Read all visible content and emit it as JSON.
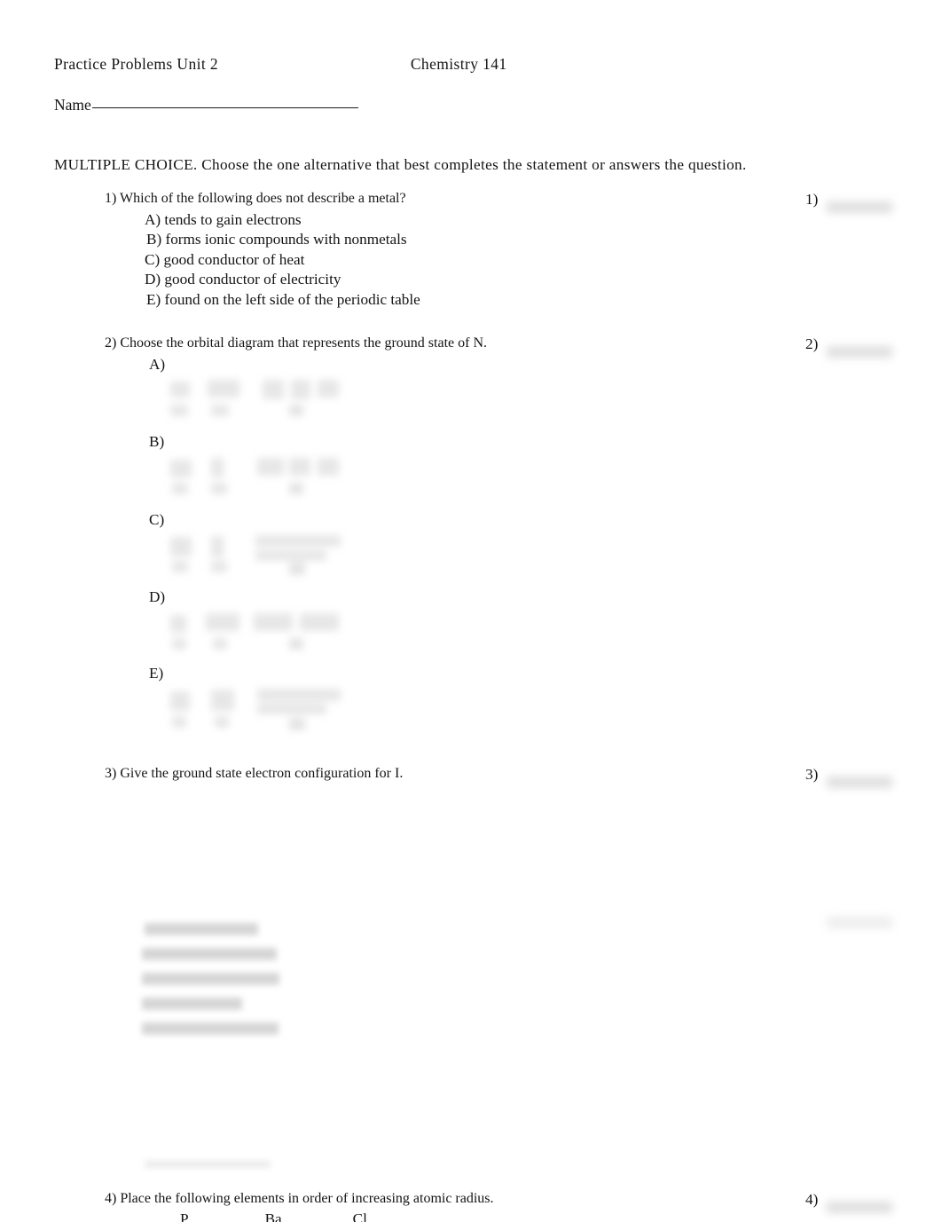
{
  "document": {
    "header_left": "Practice  Problems   Unit  2",
    "header_right": "Chemistry   141",
    "name_label": "Name",
    "instructions": "MULTIPLE  CHOICE.    Choose   the  one  alternative    that  best  completes    the  statement    or  answers   the  question."
  },
  "questions": [
    {
      "number": "1)",
      "stem": "1) Which  of the  following   does  not  describe   a metal?",
      "marker": "1)",
      "options": [
        "A) tends  to gain  electrons",
        "B) forms  ionic  compounds    with  nonmetals",
        "C) good  conductor   of heat",
        "D) good  conductor   of electricity",
        "E) found  on the  left  side  of the  periodic   table"
      ]
    },
    {
      "number": "2)",
      "stem": "2) Choose   the  orbital  diagram   that  represents    the  ground   state  of N.",
      "marker": "2)",
      "options": [
        "A)",
        "B)",
        "C)",
        "D)",
        "E)"
      ],
      "option_art": "redacted-orbital-diagram"
    },
    {
      "number": "3)",
      "stem": "3) Give  the  ground   state  electron  configuration     for I.",
      "marker": "3)",
      "options": [
        "redacted-option-a",
        "redacted-option-b",
        "redacted-option-c",
        "redacted-option-d",
        "redacted-option-e"
      ]
    },
    {
      "number": "4)",
      "stem": "4) Place  the  following   elements   in order  of increasing   atomic  radius.",
      "marker": "4)",
      "elements": [
        "P",
        "Ba",
        "Cl"
      ]
    }
  ],
  "colors": {
    "text": "#141414",
    "rule": "#1a1a1a",
    "redaction": "#cfcfcf",
    "page": "#ffffff"
  }
}
